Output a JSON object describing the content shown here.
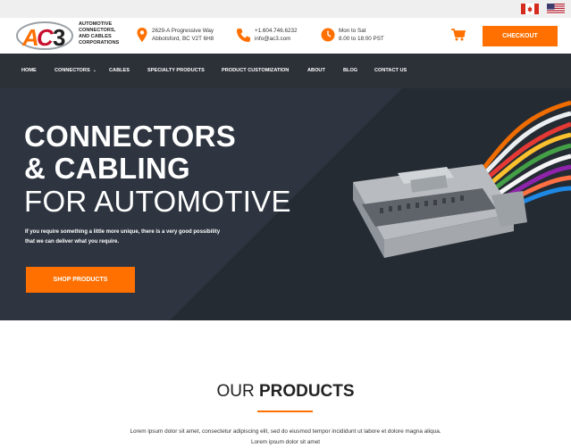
{
  "flags": {
    "canada": "canada-flag-icon",
    "usa": "usa-flag-icon"
  },
  "logo": {
    "mark": "AC3",
    "lines": [
      "AUTOMOTIVE",
      "CONNECTORS,",
      "AND CABLES",
      "CORPORATIONS"
    ]
  },
  "contact": {
    "address_line1": "2629-A Progressive Way",
    "address_line2": "Abbotsford, BC V2T 6H8",
    "phone": "+1.604.746.6232",
    "email": "info@ac3.com",
    "hours_line1": "Mon to Sat",
    "hours_line2": "8.00 to 18:00 PST"
  },
  "header": {
    "checkout_label": "CHECKOUT"
  },
  "nav": {
    "items": [
      {
        "label": "HOME"
      },
      {
        "label": "CONNECTORS"
      },
      {
        "label": "CABLES"
      },
      {
        "label": "SPECIALTY PRODUCTS"
      },
      {
        "label": "PRODUCT CUSTOMIZATION"
      },
      {
        "label": "ABOUT"
      },
      {
        "label": "BLOG"
      },
      {
        "label": "CONTACT US"
      }
    ]
  },
  "hero": {
    "title_line1": "CONNECTORS",
    "title_line2": "& CABLING",
    "title_line3": "FOR AUTOMOTIVE",
    "subtitle": "If you require something a little more unique, there is a very good possibility that we can deliver what you require.",
    "button_label": "SHOP PRODUCTS"
  },
  "products": {
    "title_light": "OUR ",
    "title_bold": "PRODUCTS",
    "text": "Lorem ipsum dolor sit amet, consectetur adipiscing elit, sed do eiusmod tempor incididunt ut labore et dolore magna aliqua. Lorem ipsum dolor sit amet"
  },
  "colors": {
    "accent": "#ff7000",
    "nav_bg": "#2c3138",
    "hero_bg": "#2e3540"
  }
}
